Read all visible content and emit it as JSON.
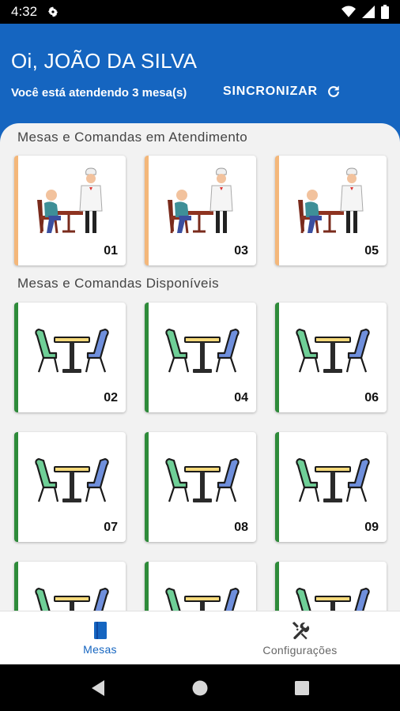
{
  "status_bar": {
    "time": "4:32"
  },
  "header": {
    "greeting": "Oi, JOÃO DA SILVA",
    "attending": "Você está atendendo 3 mesa(s)",
    "sync_label": "SINCRONIZAR"
  },
  "sections": {
    "in_service_title": "Mesas e Comandas em Atendimento",
    "available_title": "Mesas e Comandas Disponíveis"
  },
  "tables_in_service": [
    {
      "number": "01"
    },
    {
      "number": "03"
    },
    {
      "number": "05"
    }
  ],
  "tables_available": [
    {
      "number": "02"
    },
    {
      "number": "04"
    },
    {
      "number": "06"
    },
    {
      "number": "07"
    },
    {
      "number": "08"
    },
    {
      "number": "09"
    },
    {
      "number": ""
    },
    {
      "number": ""
    },
    {
      "number": ""
    }
  ],
  "bottom_nav": {
    "mesas_label": "Mesas",
    "config_label": "Configurações"
  },
  "colors": {
    "primary": "#1565c0",
    "busy_accent": "#f4b77a",
    "free_accent": "#2e8b3a"
  }
}
